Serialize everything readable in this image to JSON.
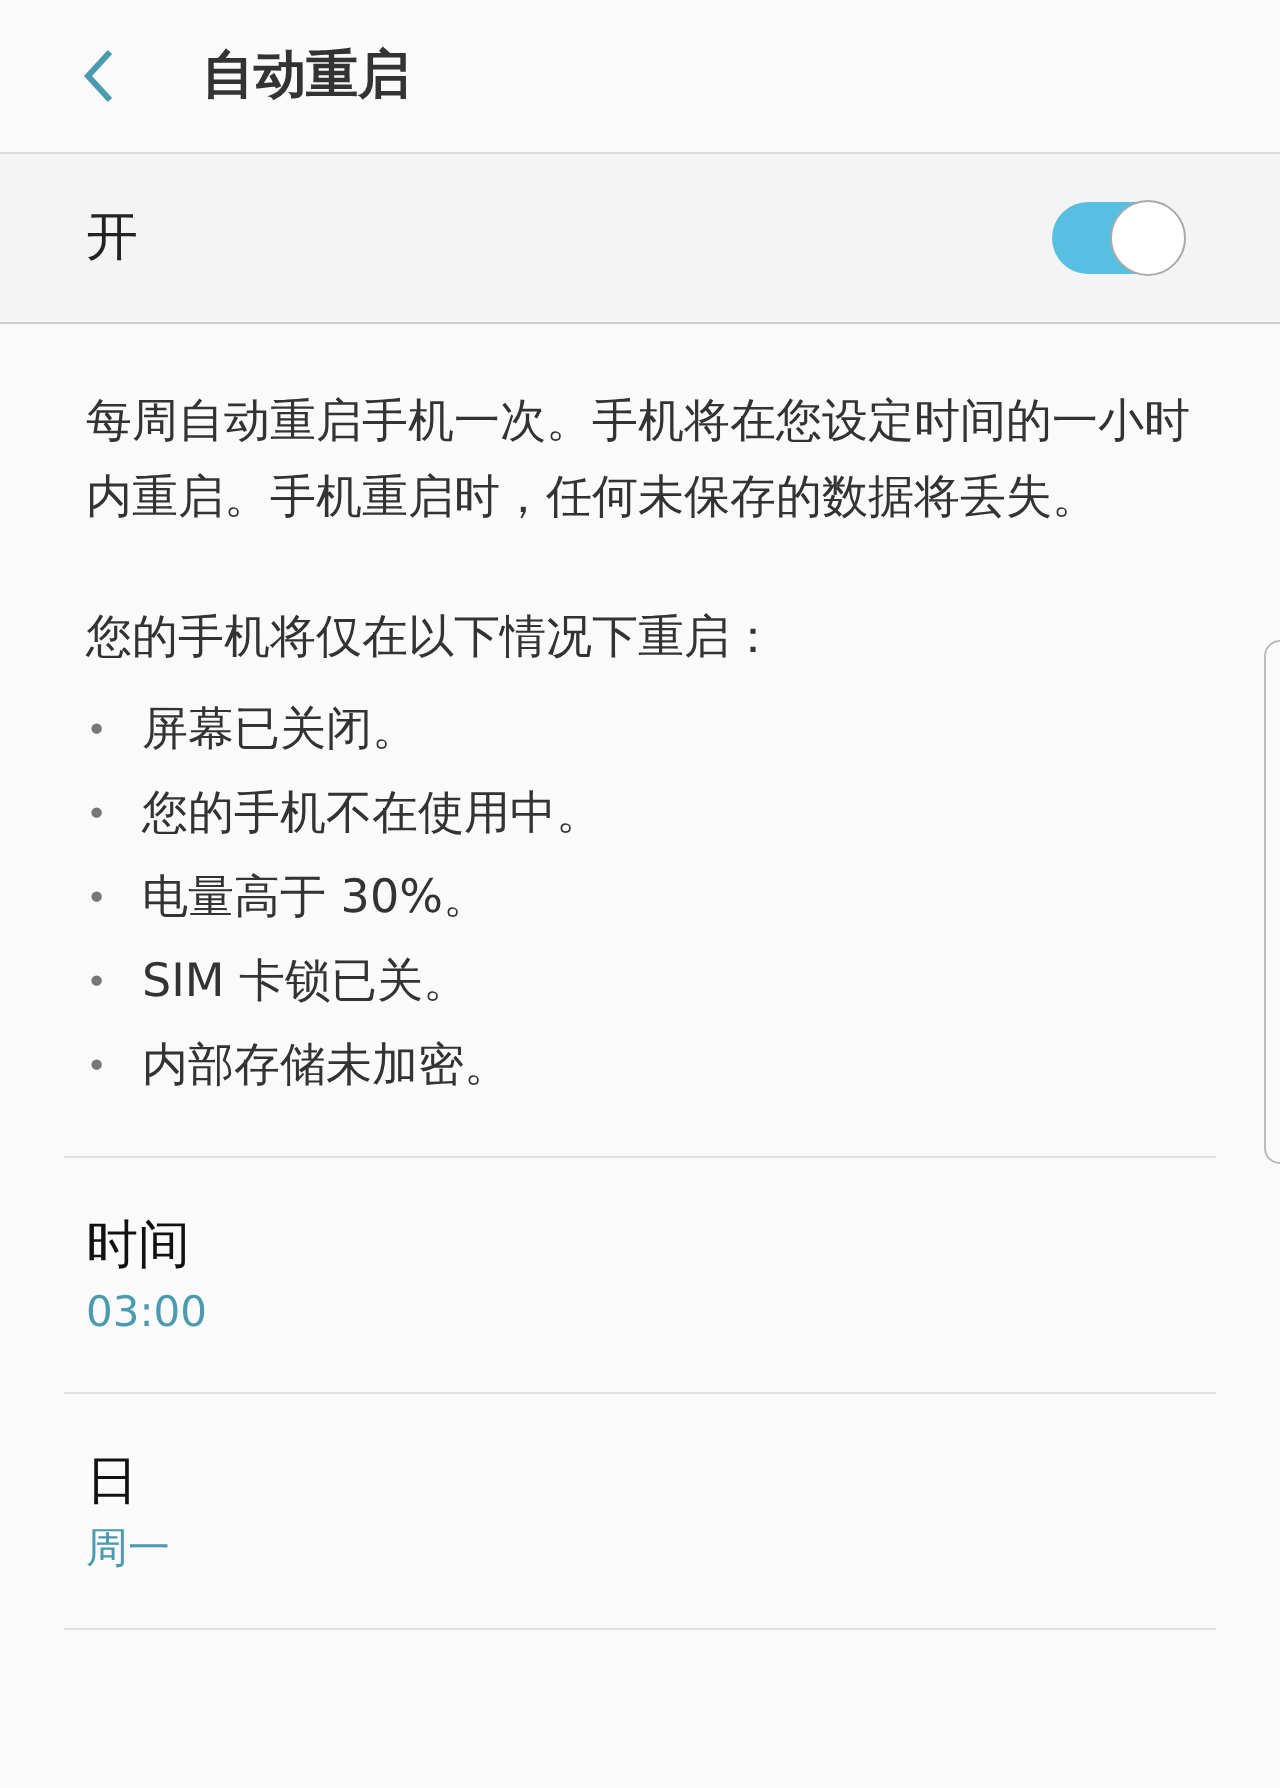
{
  "header": {
    "title": "自动重启"
  },
  "master_switch": {
    "label": "开",
    "on": true
  },
  "description": "每周自动重启手机一次。手机将在您设定时间的一小时内重启。手机重启时，任何未保存的数据将丢失。",
  "conditions": {
    "intro": "您的手机将仅在以下情况下重启：",
    "items": [
      {
        "bullet": "•",
        "text": "屏幕已关闭。"
      },
      {
        "bullet": "•",
        "text": "您的手机不在使用中。"
      },
      {
        "bullet": "•",
        "text": "电量高于 30%。"
      },
      {
        "bullet": "•",
        "text": "SIM 卡锁已关。"
      },
      {
        "bullet": "•",
        "text": "内部存储未加密。"
      }
    ]
  },
  "settings": [
    {
      "label": "时间",
      "value": "03:00"
    },
    {
      "label": "日",
      "value": "周一"
    }
  ]
}
